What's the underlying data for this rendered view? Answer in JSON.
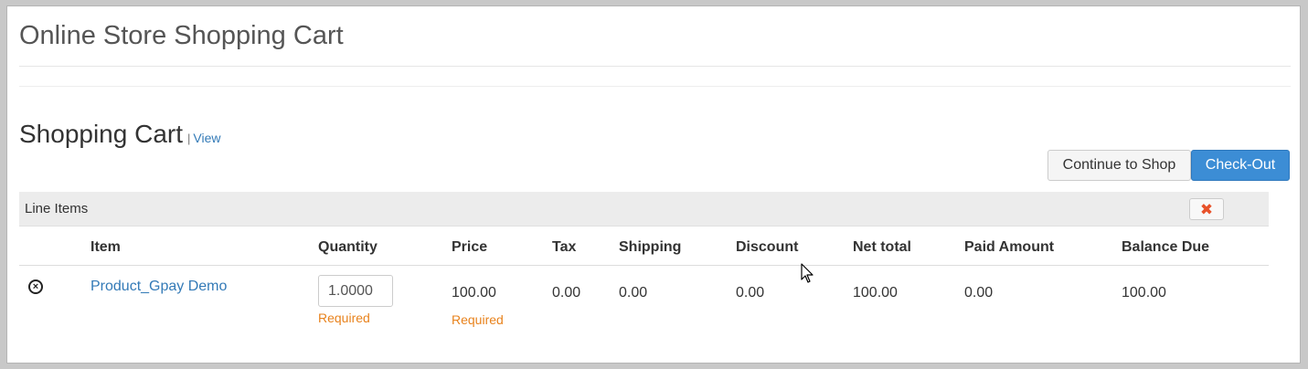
{
  "page": {
    "title": "Online Store Shopping Cart"
  },
  "cart": {
    "heading": "Shopping Cart",
    "separator": "|",
    "view_link": "View",
    "continue_label": "Continue to Shop",
    "checkout_label": "Check-Out"
  },
  "panel": {
    "title": "Line Items",
    "delete_icon": "x-icon"
  },
  "columns": [
    "Item",
    "Quantity",
    "Price",
    "Tax",
    "Shipping",
    "Discount",
    "Net total",
    "Paid Amount",
    "Balance Due"
  ],
  "line_items": [
    {
      "name": "Product_Gpay Demo",
      "quantity": "1.0000",
      "quantity_note": "Required",
      "price": "100.00",
      "price_note": "Required",
      "tax": "0.00",
      "shipping": "0.00",
      "discount": "0.00",
      "net_total": "100.00",
      "paid_amount": "0.00",
      "balance_due": "100.00"
    }
  ],
  "colors": {
    "link": "#337ab7",
    "primary": "#3c8dd5",
    "required": "#e8821c",
    "danger": "#e8522a"
  }
}
